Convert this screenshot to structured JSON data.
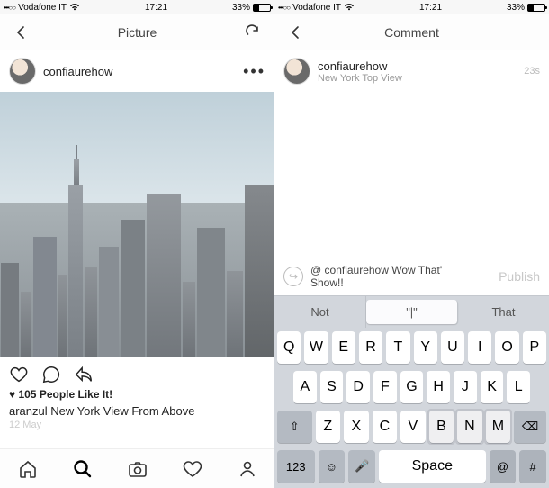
{
  "statusBar": {
    "signal": "•••○○",
    "carrier": "Vodafone IT",
    "wifi": "wifi-icon",
    "time": "17:21",
    "batteryPct": "33%"
  },
  "left": {
    "navTitle": "Picture",
    "user": "confiaurehow",
    "likes": "♥ 105 People Like It!",
    "caption": "aranzul New York View From Above",
    "date": "12 May"
  },
  "right": {
    "navTitle": "Comment",
    "user": "confiaurehow",
    "userCaption": "New York Top View",
    "timestamp": "23s",
    "input": {
      "mention": "@ confiaurehow",
      "text": " Wow That'",
      "line2": "Show!!"
    },
    "publishLabel": "Publish",
    "autocorrect": {
      "left": "Not",
      "mid": "\"|\"",
      "right": "That"
    },
    "keyboard": {
      "row1": [
        "Q",
        "W",
        "E",
        "R",
        "T",
        "Y",
        "U",
        "I",
        "O",
        "P"
      ],
      "row2": [
        "A",
        "S",
        "D",
        "F",
        "G",
        "H",
        "J",
        "K",
        "L"
      ],
      "row3": {
        "shift": "⇧",
        "keys": [
          "Z",
          "X",
          "C",
          "V",
          "B",
          "N",
          "M"
        ],
        "backspace": "⌫"
      },
      "row4": {
        "numKey": "123",
        "emoji": "☺",
        "mic": "🎤",
        "space": "Space",
        "at": "@",
        "hash": "#"
      }
    }
  }
}
